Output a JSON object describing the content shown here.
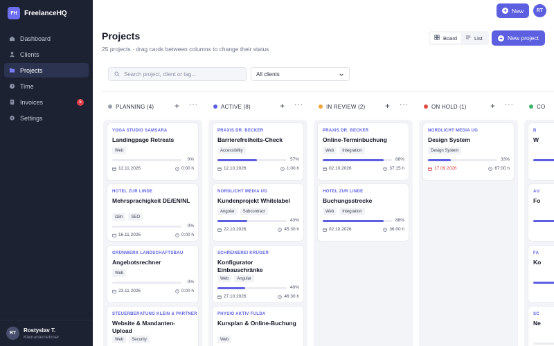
{
  "app": {
    "logo_text": "FH",
    "name": "FreelanceHQ"
  },
  "sidebar": {
    "items": [
      {
        "label": "Dashboard",
        "icon": "dashboard-icon"
      },
      {
        "label": "Clients",
        "icon": "users-icon"
      },
      {
        "label": "Projects",
        "icon": "folder-icon",
        "active": true
      },
      {
        "label": "Time",
        "icon": "clock-icon"
      },
      {
        "label": "Invoices",
        "icon": "invoice-icon",
        "badge": "5"
      },
      {
        "label": "Settings",
        "icon": "gear-icon"
      }
    ],
    "user": {
      "initials": "RT",
      "name": "Rostyslav T.",
      "role": "Kleinunternehmer"
    }
  },
  "topbar": {
    "new_label": "New",
    "avatar_initials": "RT"
  },
  "header": {
    "title": "Projects",
    "subtitle": "25 projects · drag cards between columns to change their status",
    "view_board": "Board",
    "view_list": "List",
    "new_project_label": "New project"
  },
  "filters": {
    "search_placeholder": "Search project, client or tag...",
    "client_select": "All clients"
  },
  "colors": {
    "accent": "#5b5fe0",
    "planning": "#9aa0ad",
    "active": "#5b5fe0",
    "in_review": "#f0a33a",
    "on_hold": "#e04a3f",
    "completed": "#3bb36a",
    "overdue": "#d93a3a"
  },
  "columns": [
    {
      "title": "PLANNING (4)",
      "color": "#9aa0ad",
      "cards": [
        {
          "client": "YOGA STUDIO SAMSARA",
          "title": "Landingpage Retreats",
          "tags": [
            "Web"
          ],
          "progress": 0,
          "pct": "0%",
          "date": "12.11.2026",
          "hours": "0:00 h"
        },
        {
          "client": "HOTEL ZUR LINDE",
          "title": "Mehrsprachigkeit DE/EN/NL",
          "tags": [
            "i18n",
            "SEO"
          ],
          "progress": 0,
          "pct": "0%",
          "date": "16.11.2026",
          "hours": "0:00 h"
        },
        {
          "client": "GRÜNWERK LANDSCHAFTSBAU",
          "title": "Angebotsrechner",
          "tags": [
            "Web"
          ],
          "progress": 0,
          "pct": "0%",
          "date": "23.11.2026",
          "hours": "0:00 h"
        },
        {
          "client": "STEUERBERATUNG KLEIN & PARTNER",
          "title": "Website & Mandanten-Upload",
          "tags": [
            "Web",
            "Security"
          ],
          "progress": 0,
          "pct": "",
          "date": "",
          "hours": ""
        }
      ]
    },
    {
      "title": "ACTIVE (8)",
      "color": "#5b5fe0",
      "cards": [
        {
          "client": "PRAXIS DR. BECKER",
          "title": "Barrierefreiheits-Check",
          "tags": [
            "Accessibility"
          ],
          "progress": 57,
          "pct": "57%",
          "date": "12.10.2026",
          "hours": "1:00 h"
        },
        {
          "client": "NORDLICHT MEDIA UG",
          "title": "Kundenprojekt Whitelabel",
          "tags": [
            "Angular",
            "Subcontract"
          ],
          "progress": 43,
          "pct": "43%",
          "date": "22.10.2026",
          "hours": "45:30 h"
        },
        {
          "client": "SCHREINEREI KRÜGER",
          "title": "Konfigurator Einbauschränke",
          "tags": [
            "Web",
            "Angular"
          ],
          "progress": 40,
          "pct": "40%",
          "date": "27.10.2026",
          "hours": "46:30 h"
        },
        {
          "client": "PHYSIO AKTIV FULDA",
          "title": "Kursplan & Online-Buchung",
          "tags": [
            "Web"
          ],
          "progress": 0,
          "pct": "",
          "date": "",
          "hours": ""
        }
      ]
    },
    {
      "title": "IN REVIEW (2)",
      "color": "#f0a33a",
      "cards": [
        {
          "client": "PRAXIS DR. BECKER",
          "title": "Online-Terminbuchung",
          "tags": [
            "Web",
            "Integration"
          ],
          "progress": 88,
          "pct": "88%",
          "date": "02.10.2026",
          "hours": "37:15 h"
        },
        {
          "client": "HOTEL ZUR LINDE",
          "title": "Buchungsstrecke",
          "tags": [
            "Web",
            "Integration"
          ],
          "progress": 88,
          "pct": "88%",
          "date": "02.10.2026",
          "hours": "36:00 h"
        }
      ]
    },
    {
      "title": "ON HOLD (1)",
      "color": "#e04a3f",
      "cards": [
        {
          "client": "NORDLICHT MEDIA UG",
          "title": "Design System",
          "tags": [
            "Design System"
          ],
          "progress": 33,
          "pct": "33%",
          "date": "17.09.2026",
          "hours": "67:00 h",
          "overdue": true
        }
      ]
    },
    {
      "title": "CO",
      "color": "#3bb36a",
      "cards": [
        {
          "client": "B",
          "title": "W",
          "tags": [],
          "progress": 100,
          "pct": "",
          "date": "",
          "hours": ""
        },
        {
          "client": "AU",
          "title": "Fo",
          "tags": [],
          "progress": 100,
          "pct": "",
          "date": "",
          "hours": ""
        },
        {
          "client": "FA",
          "title": "Ko",
          "tags": [],
          "progress": 100,
          "pct": "",
          "date": "",
          "hours": ""
        },
        {
          "client": "SC",
          "title": "Ne",
          "tags": [],
          "progress": 0,
          "pct": "",
          "date": "",
          "hours": ""
        }
      ]
    }
  ]
}
